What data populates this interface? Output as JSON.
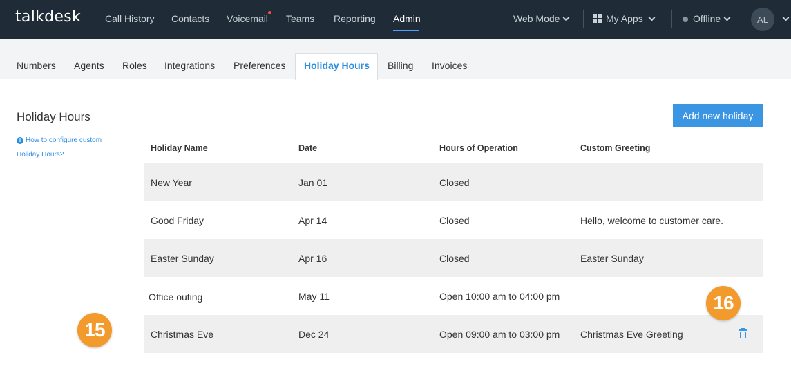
{
  "topnav": {
    "logo": "talkdesk",
    "items": [
      "Call History",
      "Contacts",
      "Voicemail",
      "Teams",
      "Reporting",
      "Admin"
    ],
    "active": "Admin",
    "mode": "Web Mode",
    "apps": "My Apps",
    "status": "Offline",
    "avatar_initials": "AL"
  },
  "subnav": {
    "tabs": [
      "Numbers",
      "Agents",
      "Roles",
      "Integrations",
      "Preferences",
      "Holiday Hours",
      "Billing",
      "Invoices"
    ],
    "active": "Holiday Hours"
  },
  "page": {
    "title": "Holiday Hours",
    "help_line1": "How to configure custom",
    "help_line2": "Holiday Hours?",
    "add_button": "Add new holiday"
  },
  "table": {
    "headers": [
      "Holiday Name",
      "Date",
      "Hours of Operation",
      "Custom Greeting"
    ],
    "rows": [
      {
        "name": "New Year",
        "date": "Jan 01",
        "hours": "Closed",
        "greeting": ""
      },
      {
        "name": "Good Friday",
        "date": "Apr 14",
        "hours": "Closed",
        "greeting": "Hello, welcome to customer care."
      },
      {
        "name": "Easter Sunday",
        "date": "Apr 16",
        "hours": "Closed",
        "greeting": "Easter Sunday"
      },
      {
        "name": "Office outing",
        "date": "May 11",
        "hours": "Open 10:00 am to 04:00 pm",
        "greeting": ""
      },
      {
        "name": "Christmas Eve",
        "date": "Dec 24",
        "hours": "Open 09:00 am to 03:00 pm",
        "greeting": "Christmas Eve Greeting"
      }
    ]
  },
  "callouts": [
    "15",
    "16"
  ],
  "colors": {
    "topbar": "#1f2b37",
    "accent": "#3a95e3",
    "callout": "#f39a2d"
  }
}
